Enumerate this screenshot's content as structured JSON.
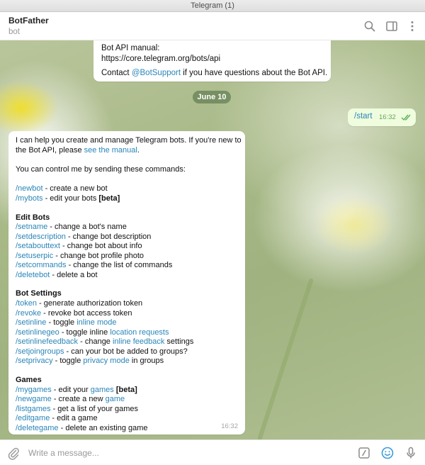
{
  "window": {
    "title": "Telegram (1)"
  },
  "chat_header": {
    "name": "BotFather",
    "status": "bot",
    "icons": [
      "search-icon",
      "sidebar-toggle-icon",
      "more-vertical-icon"
    ]
  },
  "messages": {
    "prev": {
      "line1": "Bot API manual:",
      "link": "https://core.telegram.org/bots/api",
      "line3_pre": "Contact ",
      "line3_link": "@BotSupport",
      "line3_post": " if you have questions about the Bot API."
    },
    "date_separator": "June 10",
    "outgoing": {
      "text": "/start",
      "time": "16:32",
      "status_icon": "double-check-icon"
    },
    "reply": {
      "intro1_pre": "I can help you create and manage Telegram bots. If you're new to",
      "intro2_pre": "the Bot API, please ",
      "intro2_link": "see the manual",
      "intro2_post": ".",
      "control": "You can control me by sending these commands:",
      "cmd_newbot": "/newbot",
      "desc_newbot": " - create a new bot",
      "cmd_mybots": "/mybots",
      "desc_mybots": " - edit your bots ",
      "beta1": "[beta]",
      "heading_edit": "Edit Bots",
      "cmd_setname": "/setname",
      "desc_setname": " - change a bot's name",
      "cmd_setdescription": "/setdescription",
      "desc_setdescription": " - change bot description",
      "cmd_setabouttext": "/setabouttext",
      "desc_setabouttext": " - change bot about info",
      "cmd_setuserpic": "/setuserpic",
      "desc_setuserpic": " - change bot profile photo",
      "cmd_setcommands": "/setcommands",
      "desc_setcommands": " - change the list of commands",
      "cmd_deletebot": "/deletebot",
      "desc_deletebot": " - delete a bot",
      "heading_settings": "Bot Settings",
      "cmd_token": "/token",
      "desc_token": " - generate authorization token",
      "cmd_revoke": "/revoke",
      "desc_revoke": " - revoke bot access token",
      "cmd_setinline": "/setinline",
      "desc_setinline": " - toggle ",
      "link_inline_mode": "inline mode",
      "cmd_setinlinegeo": "/setinlinegeo",
      "desc_setinlinegeo": " - toggle inline ",
      "link_location_requests": "location requests",
      "cmd_setinlinefeedback": "/setinlinefeedback",
      "desc_setinlinefeedback": " - change ",
      "link_inline_feedback": "inline feedback",
      "post_inline_feedback": " settings",
      "cmd_setjoingroups": "/setjoingroups",
      "desc_setjoingroups": " - can your bot be added to groups?",
      "cmd_setprivacy": "/setprivacy",
      "desc_setprivacy": " - toggle ",
      "link_privacy_mode": "privacy mode",
      "post_privacy_mode": " in groups",
      "heading_games": "Games",
      "cmd_mygames": "/mygames",
      "desc_mygames": " - edit your ",
      "link_games": "games",
      "beta2": " [beta]",
      "cmd_newgame": "/newgame",
      "desc_newgame": " - create a new ",
      "link_game": "game",
      "cmd_listgames": "/listgames",
      "desc_listgames": " - get a list of your games",
      "cmd_editgame": "/editgame",
      "desc_editgame": " - edit a game",
      "cmd_deletegame": "/deletegame",
      "desc_deletegame": " - delete an existing game",
      "time": "16:32"
    }
  },
  "composer": {
    "placeholder": "Write a message...",
    "icons": [
      "attach-icon",
      "bot-command-icon",
      "emoji-icon",
      "microphone-icon"
    ]
  },
  "colors": {
    "link": "#2a85b8",
    "outgoing_bubble": "#effdde",
    "date_pill": "#6a8054"
  }
}
